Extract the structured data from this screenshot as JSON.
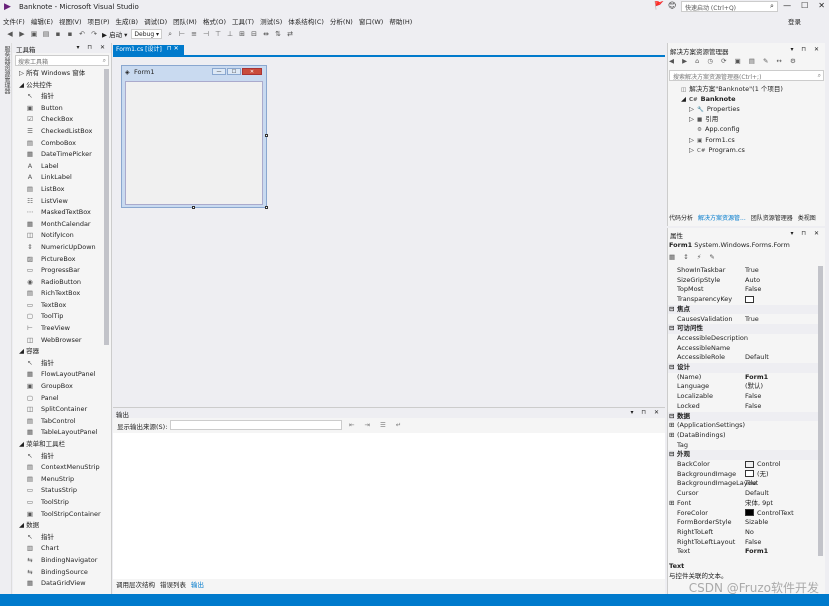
{
  "window": {
    "title": "Banknote - Microsoft Visual Studio",
    "logo": "▶",
    "controls": [
      "—",
      "☐",
      "✕"
    ],
    "notif": "🚩",
    "feedback": "😊",
    "quick_launch_placeholder": "快速启动 (Ctrl+Q)",
    "login": "登录"
  },
  "menu": [
    "文件(F)",
    "编辑(E)",
    "视图(V)",
    "项目(P)",
    "生成(B)",
    "调试(D)",
    "团队(M)",
    "格式(O)",
    "工具(T)",
    "测试(S)",
    "体系结构(C)",
    "分析(N)",
    "窗口(W)",
    "帮助(H)"
  ],
  "toolbar": {
    "start_label": "▶ 启动 ▾",
    "config": "Debug ▾"
  },
  "left_strip_label": "服务器资源管理器",
  "toolbox": {
    "title": "工具箱",
    "header_buttons": "▾ ⊓ ✕",
    "search_placeholder": "搜索工具箱",
    "groups": [
      {
        "name": "所有 Windows 窗体",
        "expanded": false,
        "items": []
      },
      {
        "name": "公共控件",
        "expanded": true,
        "items": [
          {
            "icon": "↖",
            "label": "指针"
          },
          {
            "icon": "▣",
            "label": "Button"
          },
          {
            "icon": "☑",
            "label": "CheckBox"
          },
          {
            "icon": "☰",
            "label": "CheckedListBox"
          },
          {
            "icon": "▤",
            "label": "ComboBox"
          },
          {
            "icon": "▦",
            "label": "DateTimePicker"
          },
          {
            "icon": "A",
            "label": "Label"
          },
          {
            "icon": "A",
            "label": "LinkLabel"
          },
          {
            "icon": "▤",
            "label": "ListBox"
          },
          {
            "icon": "☷",
            "label": "ListView"
          },
          {
            "icon": "⋯",
            "label": "MaskedTextBox"
          },
          {
            "icon": "▦",
            "label": "MonthCalendar"
          },
          {
            "icon": "◫",
            "label": "NotifyIcon"
          },
          {
            "icon": "⇕",
            "label": "NumericUpDown"
          },
          {
            "icon": "▨",
            "label": "PictureBox"
          },
          {
            "icon": "▭",
            "label": "ProgressBar"
          },
          {
            "icon": "◉",
            "label": "RadioButton"
          },
          {
            "icon": "▤",
            "label": "RichTextBox"
          },
          {
            "icon": "▭",
            "label": "TextBox"
          },
          {
            "icon": "▢",
            "label": "ToolTip"
          },
          {
            "icon": "⊢",
            "label": "TreeView"
          },
          {
            "icon": "◫",
            "label": "WebBrowser"
          }
        ]
      },
      {
        "name": "容器",
        "expanded": true,
        "items": [
          {
            "icon": "↖",
            "label": "指针"
          },
          {
            "icon": "▦",
            "label": "FlowLayoutPanel"
          },
          {
            "icon": "▣",
            "label": "GroupBox"
          },
          {
            "icon": "▢",
            "label": "Panel"
          },
          {
            "icon": "◫",
            "label": "SplitContainer"
          },
          {
            "icon": "▤",
            "label": "TabControl"
          },
          {
            "icon": "▦",
            "label": "TableLayoutPanel"
          }
        ]
      },
      {
        "name": "菜单和工具栏",
        "expanded": true,
        "items": [
          {
            "icon": "↖",
            "label": "指针"
          },
          {
            "icon": "▤",
            "label": "ContextMenuStrip"
          },
          {
            "icon": "▤",
            "label": "MenuStrip"
          },
          {
            "icon": "▭",
            "label": "StatusStrip"
          },
          {
            "icon": "▭",
            "label": "ToolStrip"
          },
          {
            "icon": "▣",
            "label": "ToolStripContainer"
          }
        ]
      },
      {
        "name": "数据",
        "expanded": true,
        "items": [
          {
            "icon": "↖",
            "label": "指针"
          },
          {
            "icon": "▥",
            "label": "Chart"
          },
          {
            "icon": "⇆",
            "label": "BindingNavigator"
          },
          {
            "icon": "⇆",
            "label": "BindingSource"
          },
          {
            "icon": "▦",
            "label": "DataGridView"
          }
        ]
      }
    ]
  },
  "document": {
    "tab_label": "Form1.cs [设计]",
    "tab_pin": "⊓ ✕",
    "form_title": "Form1",
    "form_icon": "◈",
    "form_buttons": [
      "—",
      "☐",
      "✕"
    ]
  },
  "output": {
    "title": "输出",
    "header_buttons": "▾ ⊓ ✕",
    "source_label": "显示输出来源(S):",
    "icons": "⇤ ⇥ ☰ ↵",
    "tabs": [
      "调用层次结构",
      "错误列表",
      "输出"
    ],
    "active_tab": 2
  },
  "solution": {
    "title": "解决方案资源管理器",
    "header_buttons": "▾ ⊓ ✕",
    "toolbar": "◀ ▶ ⌂ ◷ ⟳ ▣ ▤ ✎ ↔ ⚙",
    "search_placeholder": "搜索解决方案资源管理器(Ctrl+;)",
    "tree": [
      {
        "text": "解决方案\"Banknote\"(1 个项目)",
        "indent": 0,
        "icon": "◫",
        "expander": ""
      },
      {
        "text": "Banknote",
        "indent": 1,
        "icon": "C#",
        "expander": "◢",
        "bold": true
      },
      {
        "text": "Properties",
        "indent": 2,
        "icon": "🔧",
        "expander": "▷"
      },
      {
        "text": "引用",
        "indent": 2,
        "icon": "■",
        "expander": "▷"
      },
      {
        "text": "App.config",
        "indent": 2,
        "icon": "⚙",
        "expander": ""
      },
      {
        "text": "Form1.cs",
        "indent": 2,
        "icon": "▣",
        "expander": "▷"
      },
      {
        "text": "Program.cs",
        "indent": 2,
        "icon": "C#",
        "expander": "▷"
      }
    ],
    "tabs": [
      "代码分析",
      "解决方案资源管...",
      "团队资源管理器",
      "类视图"
    ],
    "active_tab": 1
  },
  "properties": {
    "title": "属性",
    "header_buttons": "▾ ⊓ ✕",
    "object": "Form1",
    "object_type": "System.Windows.Forms.Form",
    "toolbar": "▦ ↕ ⚡ ✎",
    "rows": [
      {
        "kind": "prop",
        "name": "ShowInTaskbar",
        "value": "True"
      },
      {
        "kind": "prop",
        "name": "SizeGripStyle",
        "value": "Auto"
      },
      {
        "kind": "prop",
        "name": "TopMost",
        "value": "False"
      },
      {
        "kind": "prop",
        "name": "TransparencyKey",
        "value": "",
        "swatch": "#ffffff"
      },
      {
        "kind": "cat",
        "name": "焦点"
      },
      {
        "kind": "prop",
        "name": "CausesValidation",
        "value": "True"
      },
      {
        "kind": "cat",
        "name": "可访问性"
      },
      {
        "kind": "prop",
        "name": "AccessibleDescription",
        "value": ""
      },
      {
        "kind": "prop",
        "name": "AccessibleName",
        "value": ""
      },
      {
        "kind": "prop",
        "name": "AccessibleRole",
        "value": "Default"
      },
      {
        "kind": "cat",
        "name": "设计"
      },
      {
        "kind": "prop",
        "name": "(Name)",
        "value": "Form1",
        "bold": true
      },
      {
        "kind": "prop",
        "name": "Language",
        "value": "(默认)"
      },
      {
        "kind": "prop",
        "name": "Localizable",
        "value": "False"
      },
      {
        "kind": "prop",
        "name": "Locked",
        "value": "False"
      },
      {
        "kind": "cat",
        "name": "数据"
      },
      {
        "kind": "prop",
        "name": "(ApplicationSettings)",
        "value": "",
        "expander": "⊞"
      },
      {
        "kind": "prop",
        "name": "(DataBindings)",
        "value": "",
        "expander": "⊞"
      },
      {
        "kind": "prop",
        "name": "Tag",
        "value": ""
      },
      {
        "kind": "cat",
        "name": "外观"
      },
      {
        "kind": "prop",
        "name": "BackColor",
        "value": "Control",
        "swatch": "#f0f0f0"
      },
      {
        "kind": "prop",
        "name": "BackgroundImage",
        "value": "(无)",
        "swatch": "#ffffff"
      },
      {
        "kind": "prop",
        "name": "BackgroundImageLayout",
        "value": "Tile"
      },
      {
        "kind": "prop",
        "name": "Cursor",
        "value": "Default"
      },
      {
        "kind": "prop",
        "name": "Font",
        "value": "宋体, 9pt",
        "expander": "⊞"
      },
      {
        "kind": "prop",
        "name": "ForeColor",
        "value": "ControlText",
        "swatch": "#000000"
      },
      {
        "kind": "prop",
        "name": "FormBorderStyle",
        "value": "Sizable"
      },
      {
        "kind": "prop",
        "name": "RightToLeft",
        "value": "No"
      },
      {
        "kind": "prop",
        "name": "RightToLeftLayout",
        "value": "False"
      },
      {
        "kind": "prop",
        "name": "Text",
        "value": "Form1",
        "bold": true
      }
    ],
    "description_title": "Text",
    "description": "与控件关联的文本。"
  },
  "watermark": "CSDN @Fruzo软件开发",
  "colors": {
    "accent": "#007acc",
    "background": "#eeeef2"
  }
}
